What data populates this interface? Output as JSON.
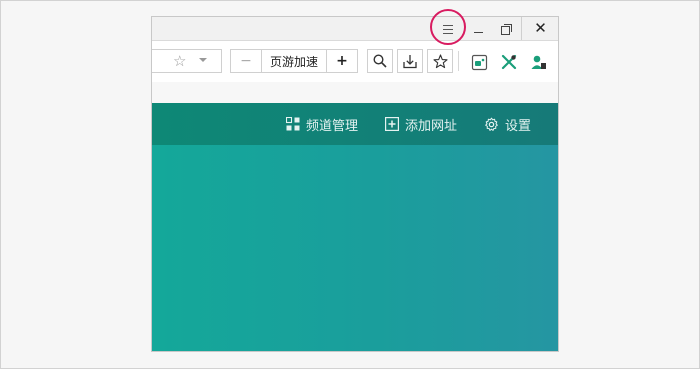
{
  "window": {
    "menu_icon": "hamburger-menu-icon",
    "minimize_icon": "minimize-icon",
    "restore_icon": "restore-icon",
    "close_icon": "close-icon",
    "close_glyph": "✕"
  },
  "toolbar": {
    "address_star": "☆",
    "zoom_minus": "−",
    "zoom_label": "页游加速",
    "zoom_plus": "+",
    "icons": [
      "search-icon",
      "download-icon",
      "favorite-star-icon",
      "game-extension-icon",
      "tool-extension-icon",
      "user-extension-icon"
    ]
  },
  "nav": {
    "channel_label": "频道管理",
    "add_label": "添加网址",
    "settings_label": "设置"
  },
  "colors": {
    "highlight_ring": "#d81b60",
    "nav_bg": "#0e8876",
    "content_bg": "#14a89a",
    "extension_green": "#1a9e7a"
  }
}
